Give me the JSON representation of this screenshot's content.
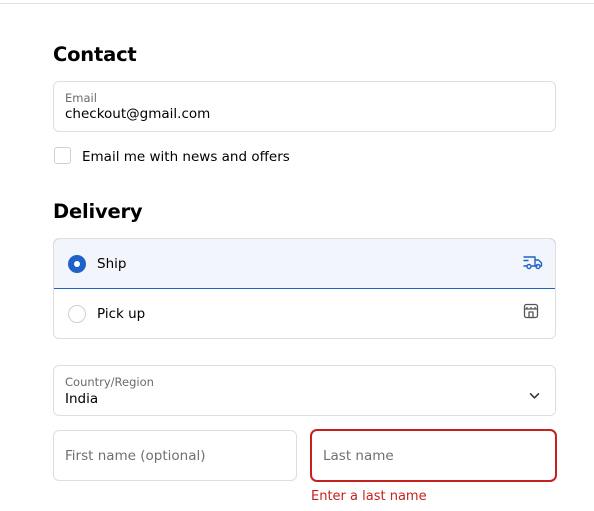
{
  "contact": {
    "title": "Contact",
    "email_label": "Email",
    "email_value": "checkout@gmail.com",
    "news_checkbox_label": "Email me with news and offers",
    "news_checked": false
  },
  "delivery": {
    "title": "Delivery",
    "options": [
      {
        "label": "Ship",
        "selected": true,
        "icon": "truck-icon"
      },
      {
        "label": "Pick up",
        "selected": false,
        "icon": "store-icon"
      }
    ],
    "country_label": "Country/Region",
    "country_value": "India",
    "first_name_placeholder": "First name (optional)",
    "last_name_placeholder": "Last name",
    "last_name_error": "Enter a last name"
  },
  "colors": {
    "accent": "#1f62c7",
    "selected_bg": "#f3f5fc",
    "error": "#c5221f",
    "border": "#dedede"
  }
}
